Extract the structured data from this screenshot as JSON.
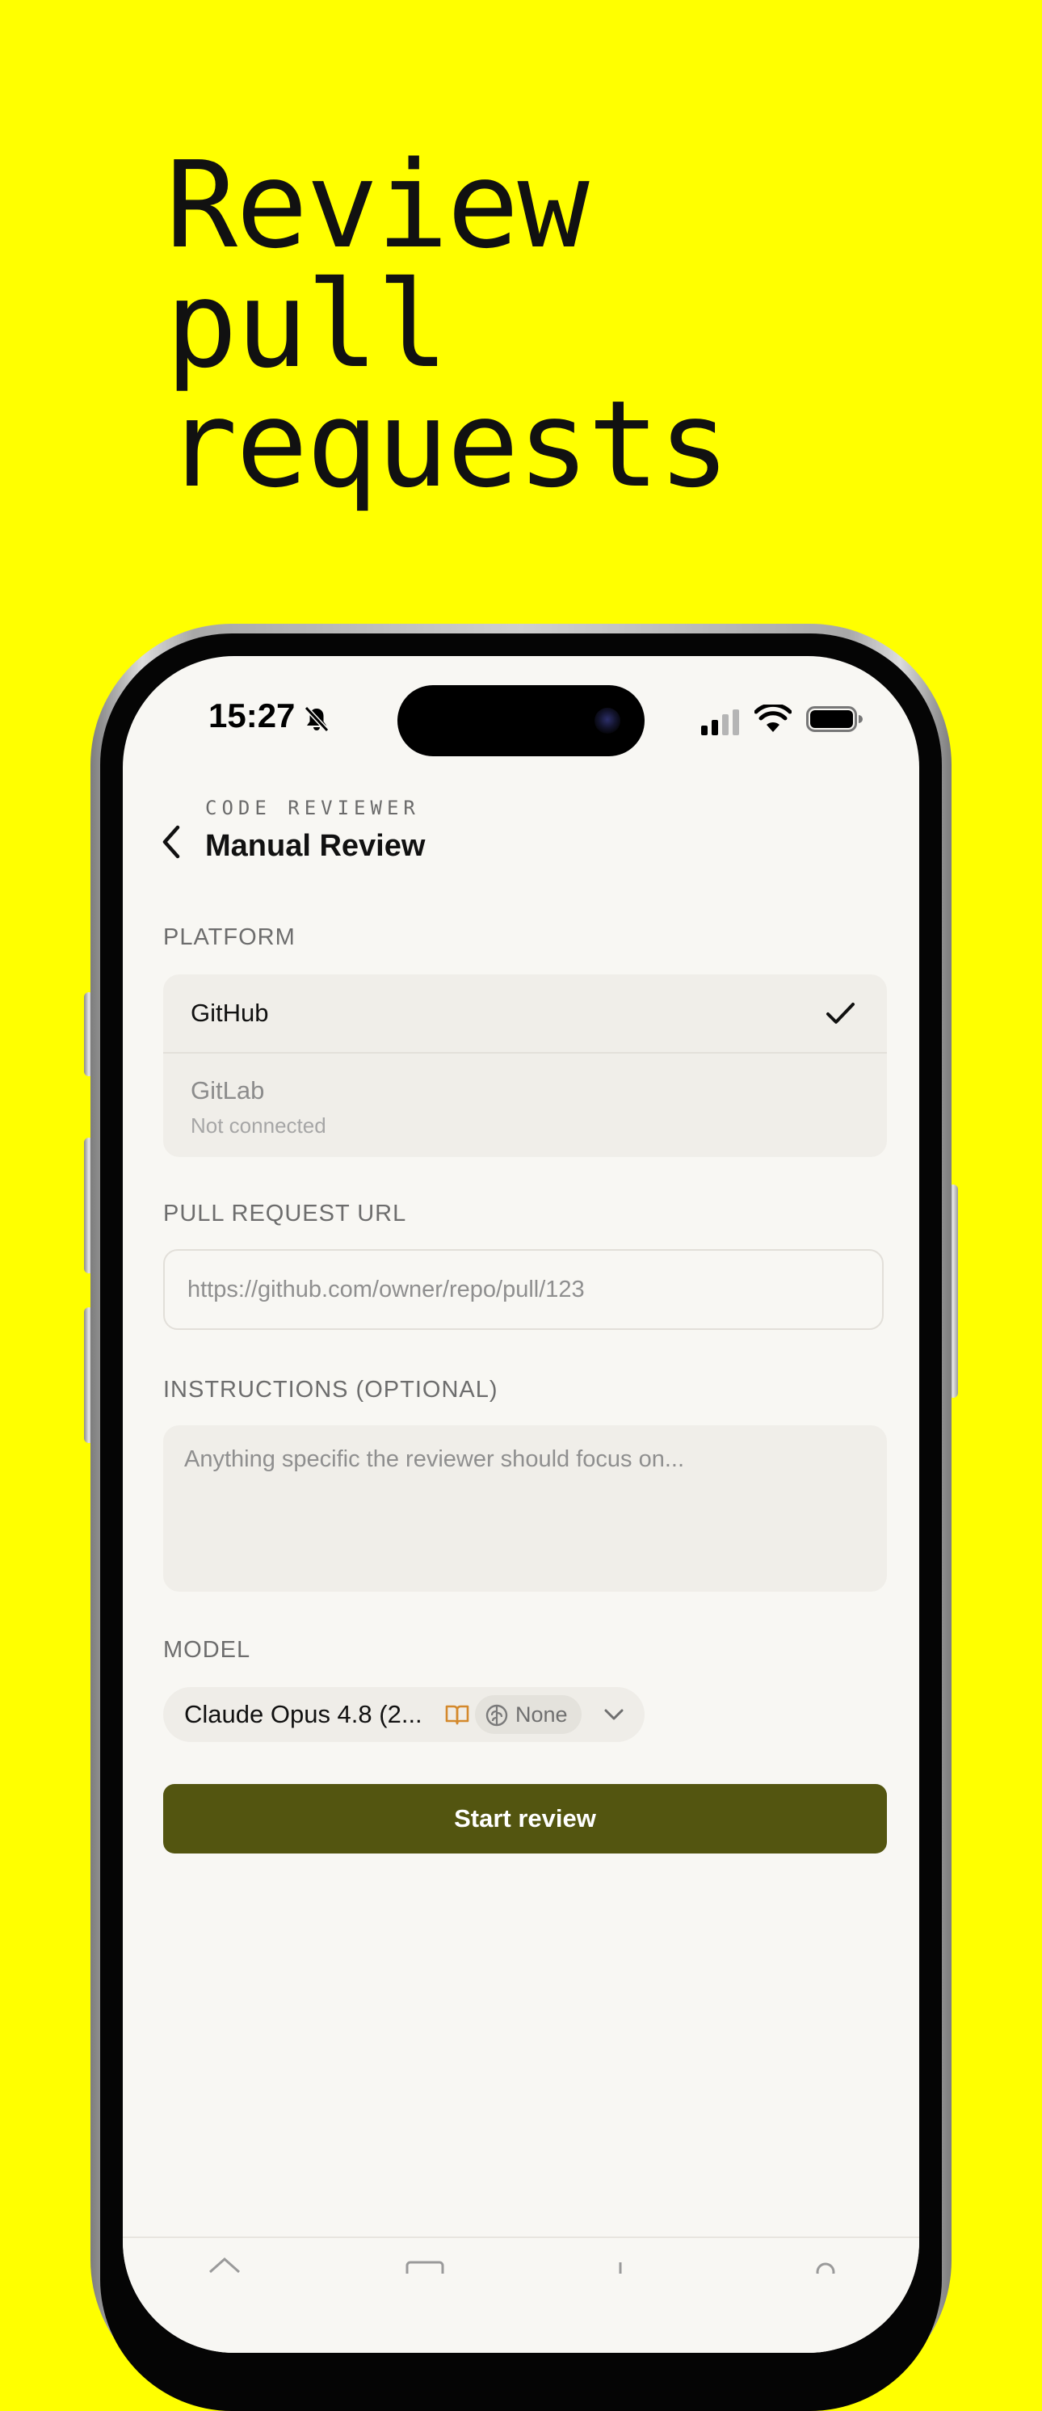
{
  "hero": {
    "lines": [
      "Review",
      "pull",
      "requests"
    ]
  },
  "status_bar": {
    "time": "15:27"
  },
  "header": {
    "eyebrow": "CODE REVIEWER",
    "title": "Manual Review"
  },
  "platform": {
    "label": "PLATFORM",
    "options": [
      {
        "name": "GitHub",
        "selected": true
      },
      {
        "name": "GitLab",
        "subtitle": "Not connected",
        "selected": false
      }
    ]
  },
  "pull_request": {
    "label": "PULL REQUEST URL",
    "placeholder": "https://github.com/owner/repo/pull/123"
  },
  "instructions": {
    "label": "INSTRUCTIONS (OPTIONAL)",
    "placeholder": "Anything specific the reviewer should focus on..."
  },
  "model": {
    "label": "MODEL",
    "name": "Claude Opus 4.8 (2...",
    "thinking": "None"
  },
  "actions": {
    "start_label": "Start review"
  },
  "colors": {
    "background": "#FFFF00",
    "screen": "#F8F7F3",
    "primary_button": "#535510",
    "accent_orange": "#D4892C"
  },
  "icons": [
    "back-chevron-icon",
    "bell-slash-icon",
    "signal-icon",
    "wifi-icon",
    "battery-icon",
    "checkmark-icon",
    "book-icon",
    "brain-icon",
    "chevron-down-icon"
  ]
}
